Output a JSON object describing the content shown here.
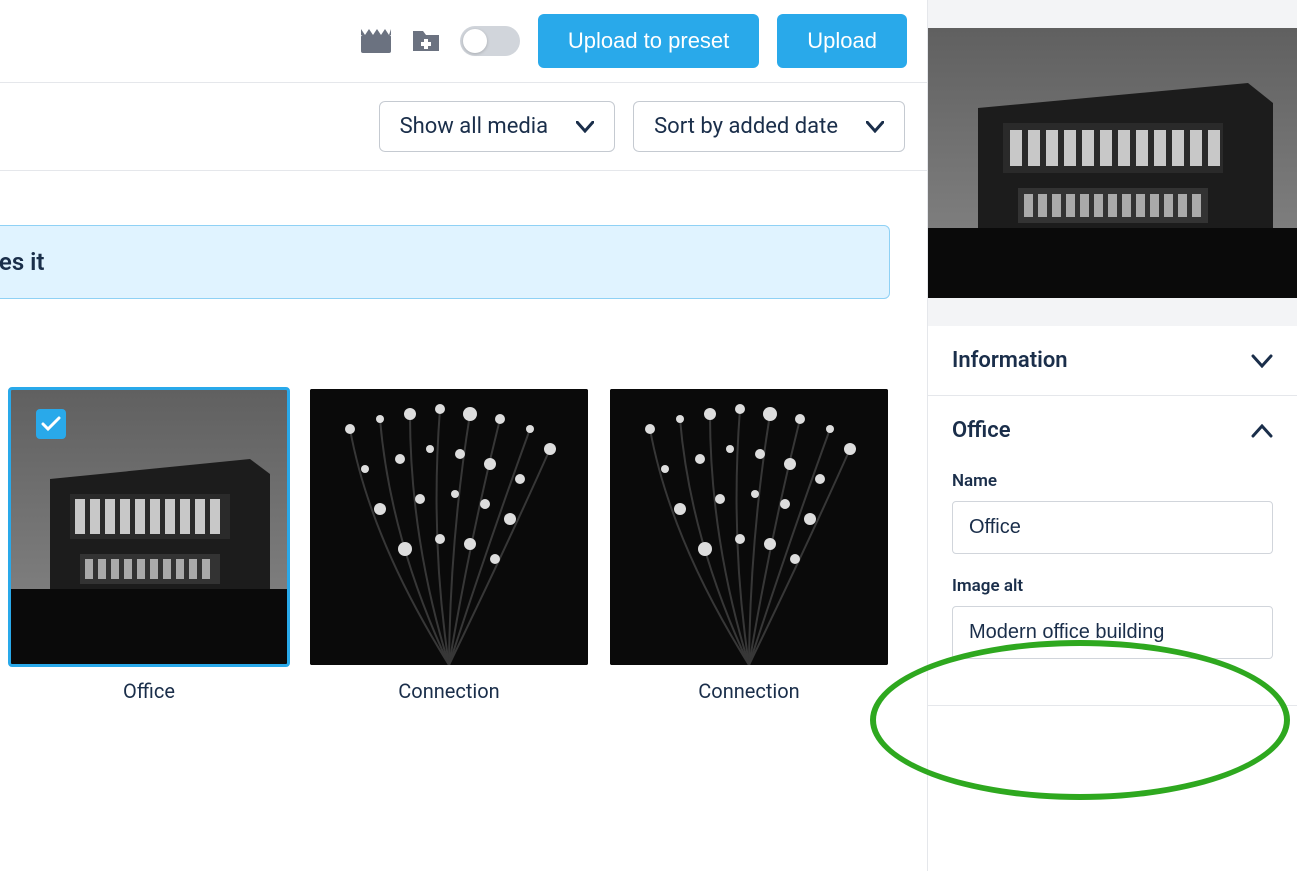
{
  "toolbar": {
    "upload_preset_label": "Upload to preset",
    "upload_label": "Upload"
  },
  "filters": {
    "media_filter": "Show all media",
    "sort": "Sort by added date"
  },
  "banner": {
    "text_fragment": "nd – no matter who creates it"
  },
  "gallery": [
    {
      "label": "Office",
      "selected": true,
      "type": "building"
    },
    {
      "label": "Connection",
      "selected": false,
      "type": "fiber"
    },
    {
      "label": "Connection",
      "selected": false,
      "type": "fiber"
    }
  ],
  "sidebar": {
    "sections": {
      "information": {
        "title": "Information",
        "expanded": false
      },
      "office": {
        "title": "Office",
        "expanded": true,
        "fields": {
          "name": {
            "label": "Name",
            "value": "Office"
          },
          "image_alt": {
            "label": "Image alt",
            "value": "Modern office building"
          }
        }
      }
    }
  }
}
